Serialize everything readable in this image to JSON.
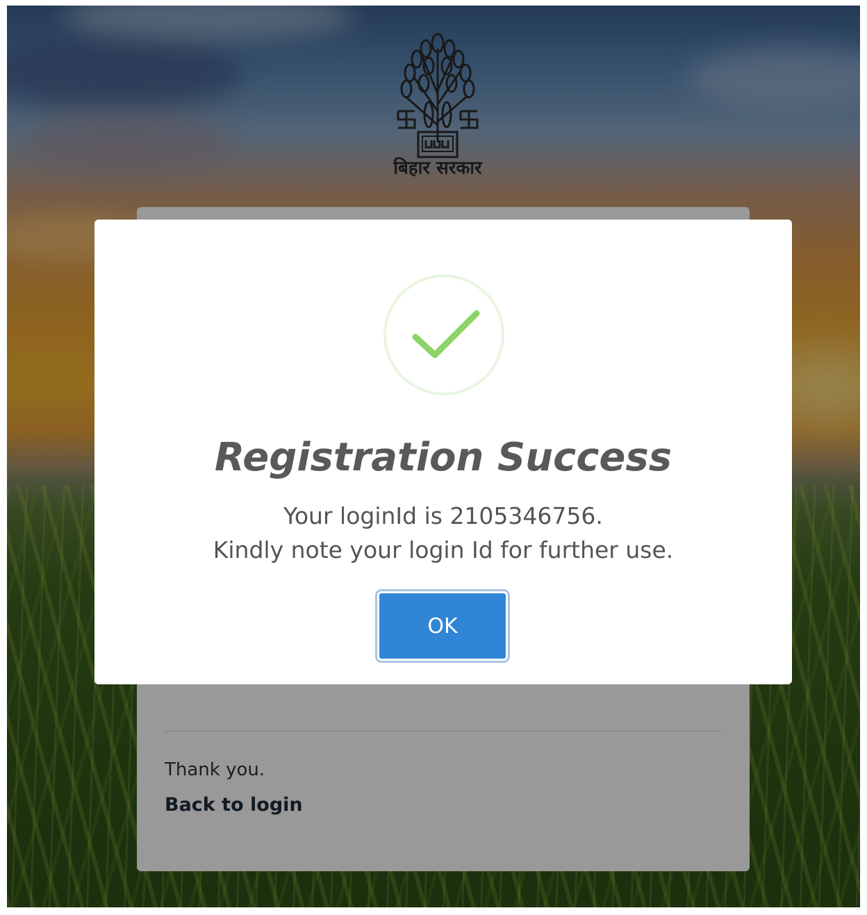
{
  "header": {
    "emblem_icon": "bihar-government-emblem-icon",
    "emblem_caption": "बिहार सरकार"
  },
  "background_card": {
    "thanks_text": "Thank you.",
    "back_to_login_label": "Back to login"
  },
  "modal": {
    "icon": "success-check-icon",
    "title": "Registration Success",
    "message_line1": "Your loginId is 2105346756.",
    "message_line2": "Kindly note your login Id for further use.",
    "ok_label": "OK"
  },
  "colors": {
    "success_green": "#a5dc86",
    "button_blue": "#3085d6",
    "title_gray": "#595959"
  }
}
